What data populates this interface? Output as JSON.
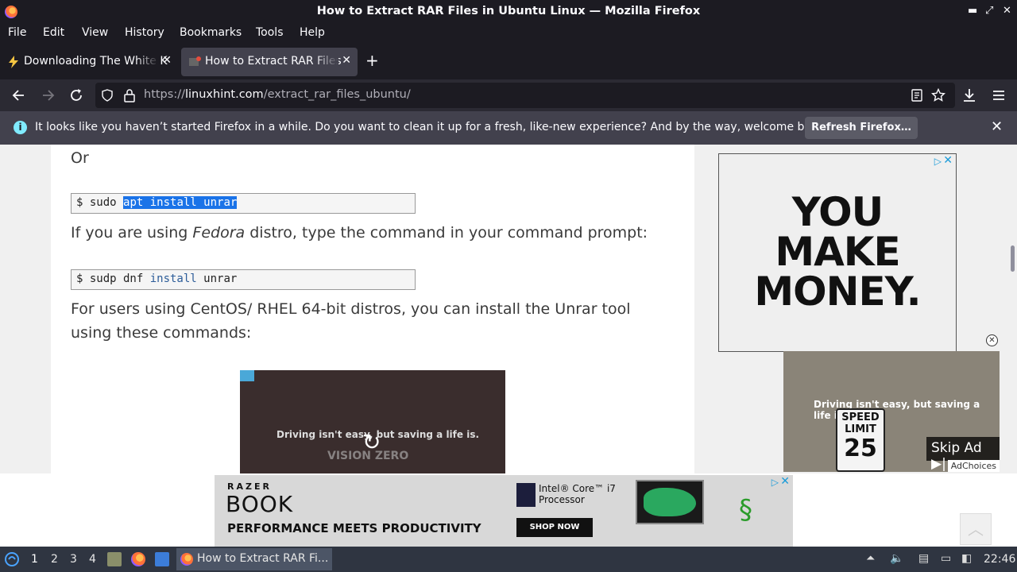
{
  "window": {
    "title": "How to Extract RAR Files in Ubuntu Linux — Mozilla Firefox",
    "minimize": "▬",
    "maximize": "⤢",
    "close": "✕"
  },
  "menubar": [
    "File",
    "Edit",
    "View",
    "History",
    "Bookmarks",
    "Tools",
    "Help"
  ],
  "tabs": [
    {
      "label": "Downloading The White K",
      "icon": "lightning-icon",
      "close": "✕",
      "active": false
    },
    {
      "label": "How to Extract RAR Files",
      "icon": "linuxhint-favicon",
      "close": "✕",
      "active": true
    }
  ],
  "new_tab": "+",
  "nav": {
    "url_prefix": "https://",
    "url_domain": "linuxhint.com",
    "url_path": "/extract_rar_files_ubuntu/"
  },
  "notification": {
    "message": "It looks like you haven’t started Firefox in a while. Do you want to clean it up for a fresh, like-new experience? And by the way, welcome back!",
    "button": "Refresh Firefox…",
    "close": "✕"
  },
  "article": {
    "or_text": "Or",
    "cmd1_prompt": "$ sudo ",
    "cmd1_selected": "apt install unrar",
    "fedora_pre": "If you are using ",
    "fedora_em": "Fedora",
    "fedora_post": " distro, type the command in your command prompt:",
    "cmd2_prompt": "$ sudp dnf ",
    "cmd2_kw": "install",
    "cmd2_rest": " unrar",
    "centos_text": "For users using CentOS/ RHEL 64-bit distros, you can install the Unrar tool using these commands:",
    "video_caption": "Driving isn't easy, but saving a life is.",
    "video_watermark": "VISION ZERO"
  },
  "side_ad": {
    "line1": "YOU",
    "line2": "MAKE",
    "line3": "MONEY."
  },
  "video_ad": {
    "caption": "Driving isn't easy, but saving a life is.",
    "sign_top": "SPEED LIMIT",
    "sign_num": "25",
    "skip": "Skip Ad ▶|",
    "adchoices": "AdChoices"
  },
  "bottom_ad": {
    "brand": "RAZER",
    "product": "BOOK",
    "tagline": "PERFORMANCE MEETS PRODUCTIVITY",
    "cta": "SHOP NOW",
    "intel_line1": "Intel® Core™ i7",
    "intel_line2": "Processor"
  },
  "taskbar": {
    "workspaces": [
      "1",
      "2",
      "3",
      "4"
    ],
    "window_label": "How to Extract RAR Fi...",
    "clock": "22:46"
  }
}
